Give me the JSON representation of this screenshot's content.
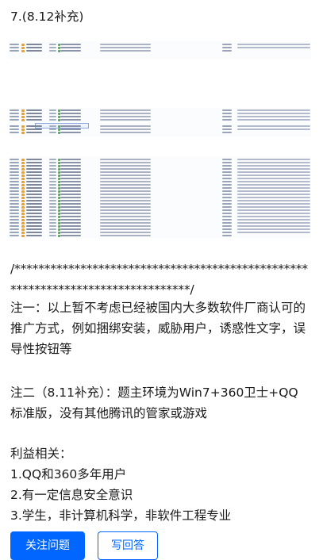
{
  "heading": "7.(8.12补充)",
  "separator": "/*******************************************************************************/",
  "note1": "注一：以上暂不考虑已经被国内大多数软件厂商认可的推广方式，例如捆绑安装，威胁用户，诱惑性文字，误导性按钮等",
  "note2": "注二（8.11补充）：题主环境为Win7+360卫士+QQ标准版，没有其他腾讯的管家或游戏",
  "interest": {
    "title": "利益相关：",
    "items": [
      "1.QQ和360多年用户",
      "2.有一定信息安全意识",
      "3.学生，非计算机科学，非软件工程专业"
    ]
  },
  "actions": {
    "follow": "关注问题",
    "answer": "写回答"
  },
  "colors": {
    "accent": "#0066ff"
  }
}
